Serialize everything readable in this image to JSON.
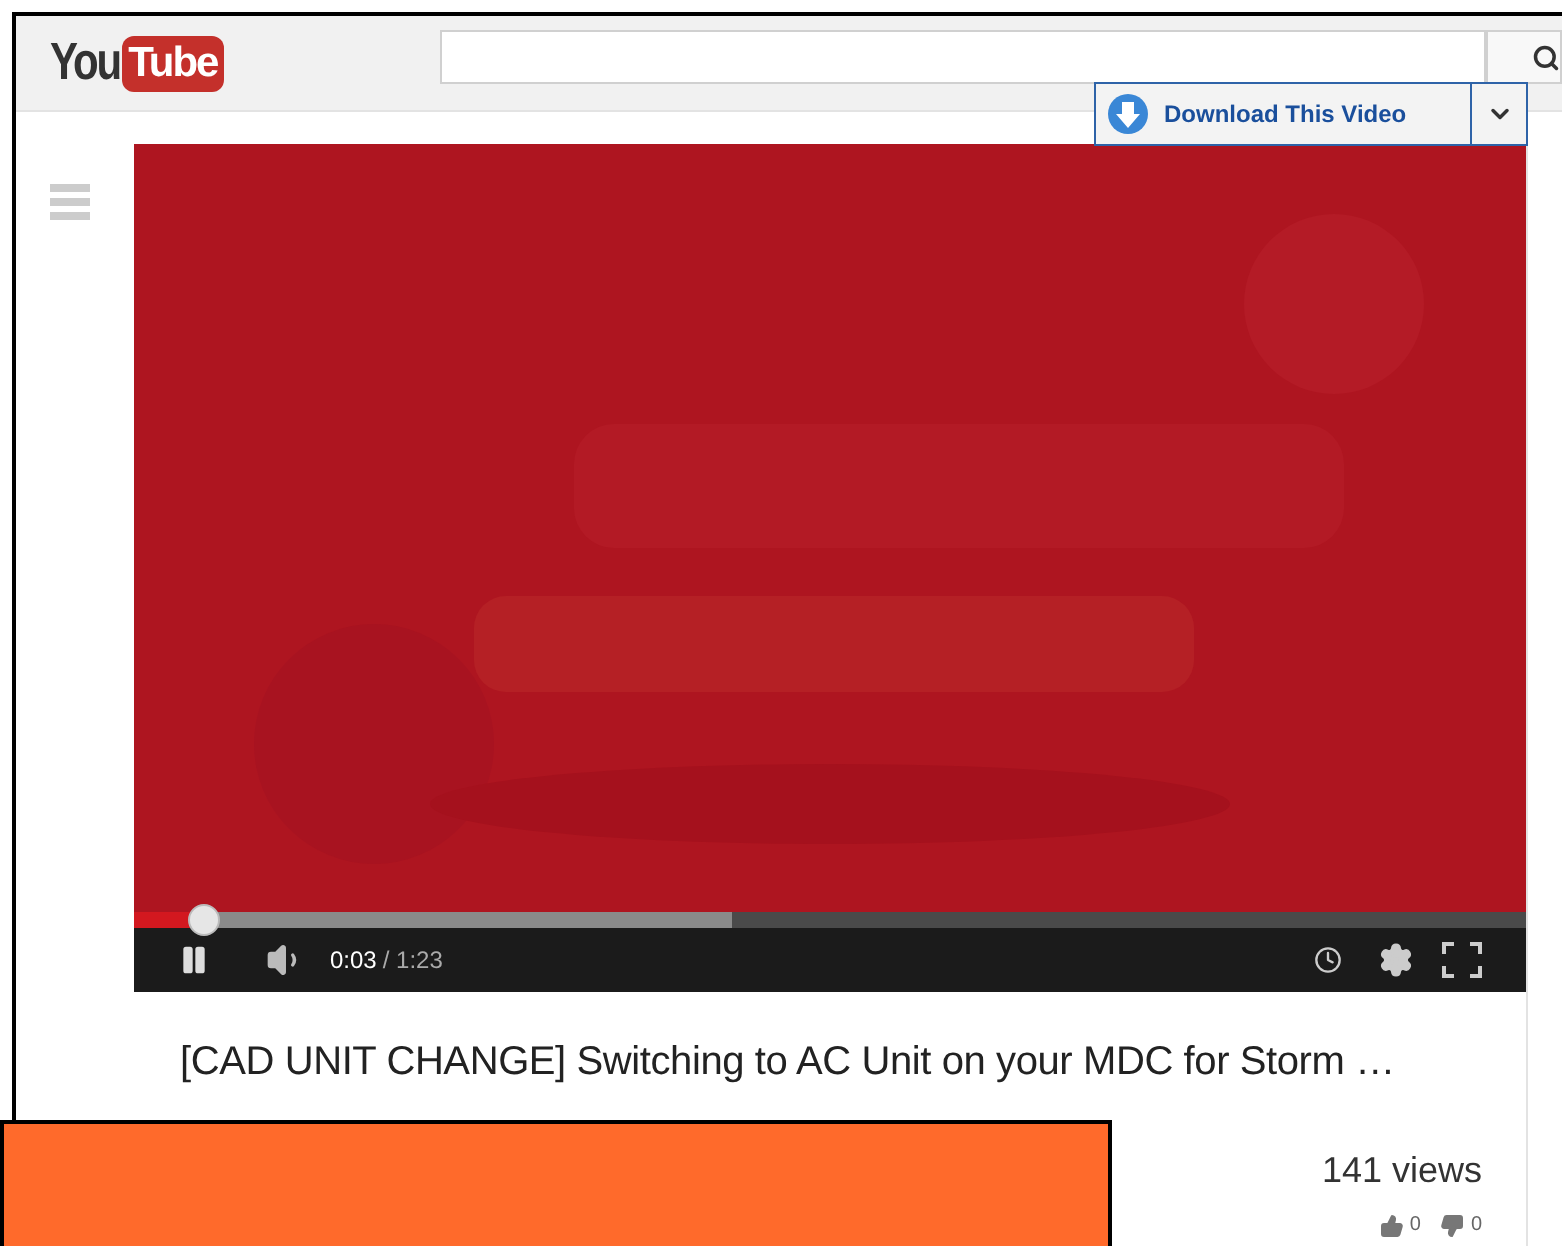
{
  "header": {
    "logo": {
      "first": "You",
      "second": "Tube"
    }
  },
  "download_button": {
    "label": "Download This Video"
  },
  "player": {
    "progress": {
      "level": 0.05
    },
    "buffered": {
      "level": 0.43
    },
    "playing": true,
    "current_time": "0:03",
    "duration": "/ 1:23"
  },
  "video": {
    "title": "[CAD UNIT CHANGE] Switching to AC Unit on your MDC for Storm …",
    "views": "141 views",
    "likes": "0",
    "dislikes": "0"
  }
}
